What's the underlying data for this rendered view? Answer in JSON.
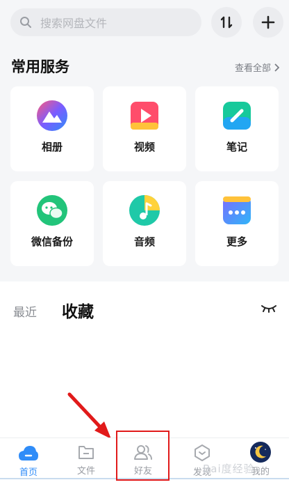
{
  "search": {
    "placeholder": "搜索网盘文件"
  },
  "services": {
    "title": "常用服务",
    "view_all": "查看全部",
    "items": [
      {
        "label": "相册",
        "icon": "photo-album-icon"
      },
      {
        "label": "视频",
        "icon": "video-icon"
      },
      {
        "label": "笔记",
        "icon": "notes-icon"
      },
      {
        "label": "微信备份",
        "icon": "wechat-backup-icon"
      },
      {
        "label": "音频",
        "icon": "audio-icon"
      },
      {
        "label": "更多",
        "icon": "more-icon"
      }
    ]
  },
  "tabs": {
    "recent": "最近",
    "favorites": "收藏"
  },
  "nav": {
    "items": [
      {
        "label": "首页",
        "icon": "home-cloud-icon",
        "active": true
      },
      {
        "label": "文件",
        "icon": "folder-icon",
        "active": false
      },
      {
        "label": "好友",
        "icon": "friends-icon",
        "active": false
      },
      {
        "label": "发现",
        "icon": "discover-icon",
        "active": false
      },
      {
        "label": "我的",
        "icon": "profile-avatar-icon",
        "active": false
      }
    ]
  },
  "watermark": "Bai度经验",
  "colors": {
    "accent": "#2f8cf8",
    "annotation": "#e11a1a",
    "background": "#f5f6f8"
  }
}
